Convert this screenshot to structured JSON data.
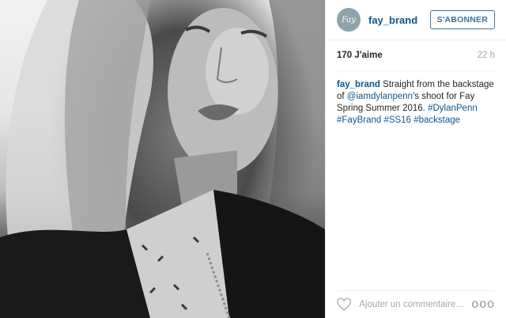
{
  "post": {
    "author": "fay_brand",
    "avatar_text": "Fay",
    "follow_label": "S'ABONNER",
    "likes": "170 J'aime",
    "time": "22 h",
    "caption": {
      "author": "fay_brand",
      "text_1": "Straight from the backstage of",
      "mention": "@iamdylanpenn",
      "text_2": "'s shoot for Fay Spring Summer 2016.",
      "tags": [
        "#DylanPenn",
        "#FayBrand",
        "#SS16",
        "#backstage"
      ]
    },
    "comment_placeholder": "Ajouter un commentaire...",
    "more_label": "ooo"
  },
  "icons": {
    "like": "heart-icon",
    "more": "more-options-icon"
  },
  "colors": {
    "link": "#125688",
    "follow": "#3f729b",
    "avatar": "#8ea3ab"
  }
}
